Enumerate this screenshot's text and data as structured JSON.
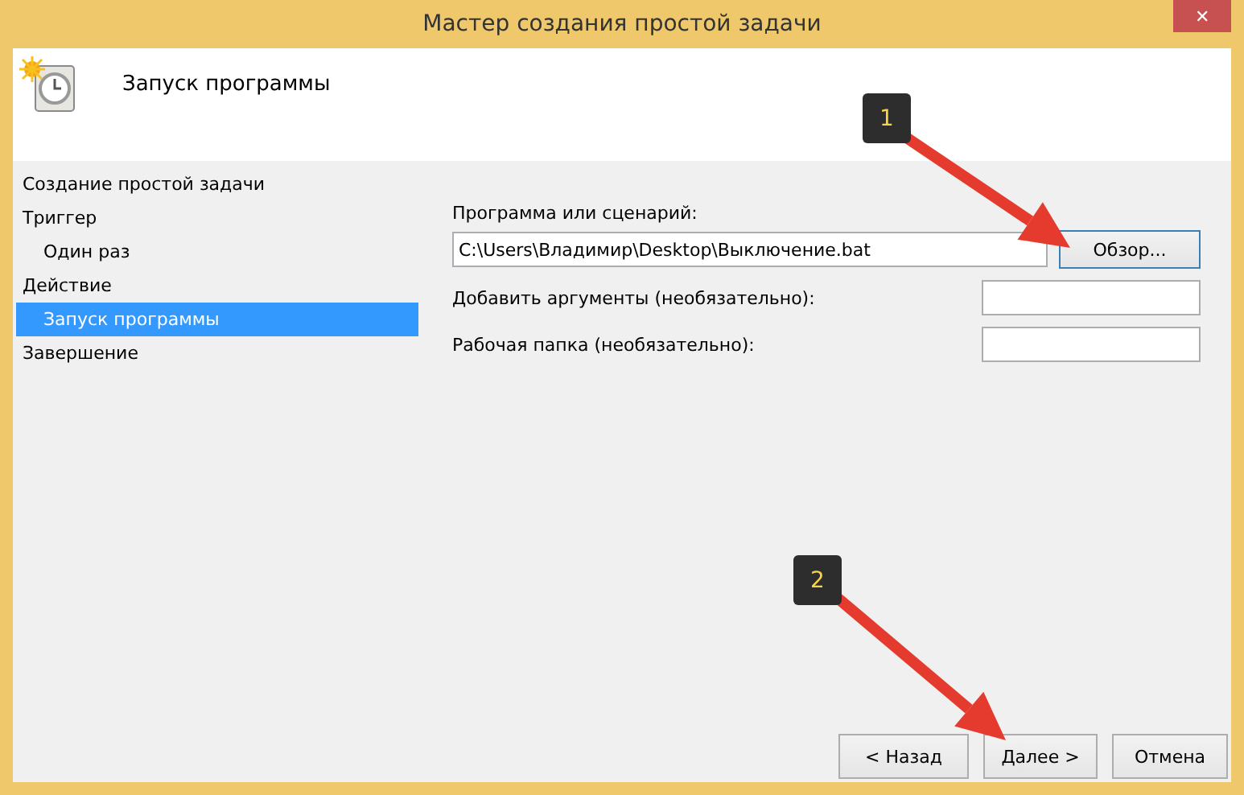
{
  "window": {
    "title": "Мастер создания простой задачи",
    "close": "✕"
  },
  "header": {
    "title": "Запуск программы"
  },
  "sidebar": {
    "items": [
      {
        "label": "Создание простой задачи",
        "selected": false
      },
      {
        "label": "Триггер",
        "selected": false,
        "children": [
          {
            "label": "Один раз",
            "selected": false
          }
        ]
      },
      {
        "label": "Действие",
        "selected": false,
        "children": [
          {
            "label": "Запуск программы",
            "selected": true
          }
        ]
      },
      {
        "label": "Завершение",
        "selected": false
      }
    ]
  },
  "form": {
    "program": {
      "label": "Программа или сценарий:",
      "value": "C:\\Users\\Владимир\\Desktop\\Выключение.bat",
      "browse": "Обзор..."
    },
    "fields": [
      {
        "label": "Добавить аргументы (необязательно):"
      },
      {
        "label": "Рабочая папка (необязательно):"
      }
    ]
  },
  "buttons": [
    {
      "label": "< Назад",
      "kind": "back"
    },
    {
      "label": "Далее >",
      "kind": "next"
    },
    {
      "label": "Отмена",
      "kind": "cancel"
    }
  ],
  "annotations": [
    {
      "label": "1"
    },
    {
      "label": "2"
    }
  ]
}
